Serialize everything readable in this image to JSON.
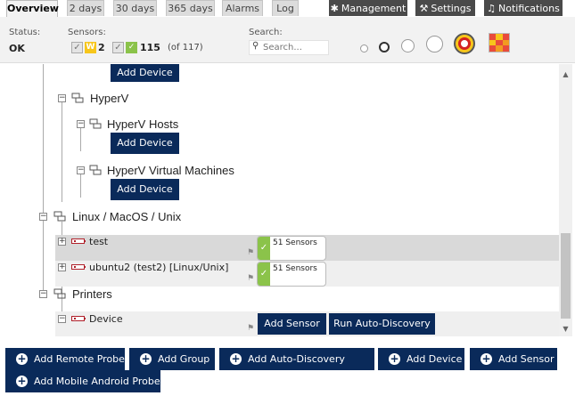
{
  "tabs": [
    {
      "label": "Overview",
      "active": true
    },
    {
      "label": "2 days"
    },
    {
      "label": "30 days"
    },
    {
      "label": "365 days"
    },
    {
      "label": "Alarms"
    },
    {
      "label": "Log"
    }
  ],
  "right_tabs": [
    {
      "label": "Management",
      "icon": "gear-icon"
    },
    {
      "label": "Settings",
      "icon": "wrench-icon"
    },
    {
      "label": "Notifications",
      "icon": "bell-icon"
    }
  ],
  "status": {
    "status_label": "Status:",
    "status_value": "OK",
    "sensors_label": "Sensors:",
    "warning_badge": "W",
    "warning_count": "2",
    "ok_count": "115",
    "total": "(of 117)",
    "search_label": "Search:",
    "search_placeholder": "Search..."
  },
  "tree": {
    "top_add_device": "Add Device",
    "hyperv": "HyperV",
    "hyperv_hosts": "HyperV Hosts",
    "hyperv_hosts_add": "Add Device",
    "hyperv_vms": "HyperV Virtual Machines",
    "hyperv_vms_add": "Add Device",
    "linux": "Linux / MacOS / Unix",
    "devices": [
      {
        "label": "test",
        "sensors": "51 Sensors"
      },
      {
        "label": "ubuntu2 (test2) [Linux/Unix]",
        "sensors": "51 Sensors"
      }
    ],
    "printers": "Printers",
    "printer_device": "Device",
    "add_sensor": "Add Sensor",
    "run_auto_discovery": "Run Auto-Discovery"
  },
  "actions": [
    "Add Remote Probe",
    "Add Group",
    "Add Auto-Discovery Group",
    "Add Device",
    "Add Sensor",
    "Add Mobile Android Probe"
  ],
  "colors": {
    "brand_dark": "#0a2a5a",
    "ok_green": "#8bc34a",
    "warning_yellow": "#f7c61b"
  }
}
